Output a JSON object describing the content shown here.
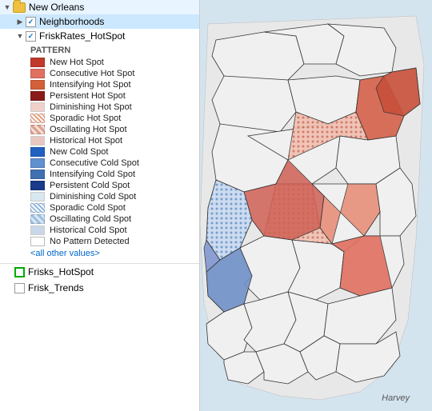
{
  "title": "New Orleans",
  "layers": {
    "root": {
      "label": "New Orleans",
      "expanded": true
    },
    "neighborhoods": {
      "label": "Neighborhoods",
      "selected": true,
      "checked": true
    },
    "friskRates": {
      "label": "FriskRates_HotSpot",
      "checked": true
    }
  },
  "pattern": {
    "header": "PATTERN",
    "items": [
      {
        "id": "new-hot",
        "label": "New Hot Spot",
        "swatchClass": "swatch-new-hot"
      },
      {
        "id": "consec-hot",
        "label": "Consecutive Hot Spot",
        "swatchClass": "swatch-consec-hot"
      },
      {
        "id": "intensify-hot",
        "label": "Intensifying Hot Spot",
        "swatchClass": "swatch-intensify-hot"
      },
      {
        "id": "persist-hot",
        "label": "Persistent Hot Spot",
        "swatchClass": "swatch-persist-hot"
      },
      {
        "id": "dim-hot",
        "label": "Diminishing Hot Spot",
        "swatchClass": "swatch-dim-hot"
      },
      {
        "id": "sporadic-hot",
        "label": "Sporadic Hot Spot",
        "swatchClass": "swatch-sporadic-hot"
      },
      {
        "id": "oscillating-hot",
        "label": "Oscillating Hot Spot",
        "swatchClass": "swatch-oscillating-hot"
      },
      {
        "id": "historical-hot",
        "label": "Historical Hot Spot",
        "swatchClass": "swatch-historical-hot"
      },
      {
        "id": "new-cold",
        "label": "New Cold Spot",
        "swatchClass": "swatch-new-cold"
      },
      {
        "id": "consec-cold",
        "label": "Consecutive Cold Spot",
        "swatchClass": "swatch-consec-cold"
      },
      {
        "id": "intensify-cold",
        "label": "Intensifying Cold Spot",
        "swatchClass": "swatch-intensify-cold"
      },
      {
        "id": "persist-cold",
        "label": "Persistent Cold Spot",
        "swatchClass": "swatch-persist-cold"
      },
      {
        "id": "dim-cold",
        "label": "Diminishing Cold Spot",
        "swatchClass": "swatch-dim-cold"
      },
      {
        "id": "sporadic-cold",
        "label": "Sporadic Cold Spot",
        "swatchClass": "swatch-sporadic-cold"
      },
      {
        "id": "oscillating-cold",
        "label": "Oscillating Cold Spot",
        "swatchClass": "swatch-oscillating-cold"
      },
      {
        "id": "historical-cold",
        "label": "Historical Cold Spot",
        "swatchClass": "swatch-historical-cold"
      },
      {
        "id": "no-pattern",
        "label": "No Pattern Detected",
        "swatchClass": "swatch-no-pattern"
      }
    ],
    "allOtherLabel": "<all other values>"
  },
  "bottomLayers": [
    {
      "id": "frisks-hotspot",
      "label": "Frisks_HotSpot",
      "greenBorder": true
    },
    {
      "id": "frisk-trends",
      "label": "Frisk_Trends",
      "checked": false
    }
  ],
  "map": {
    "harveyLabel": "Harvey"
  }
}
